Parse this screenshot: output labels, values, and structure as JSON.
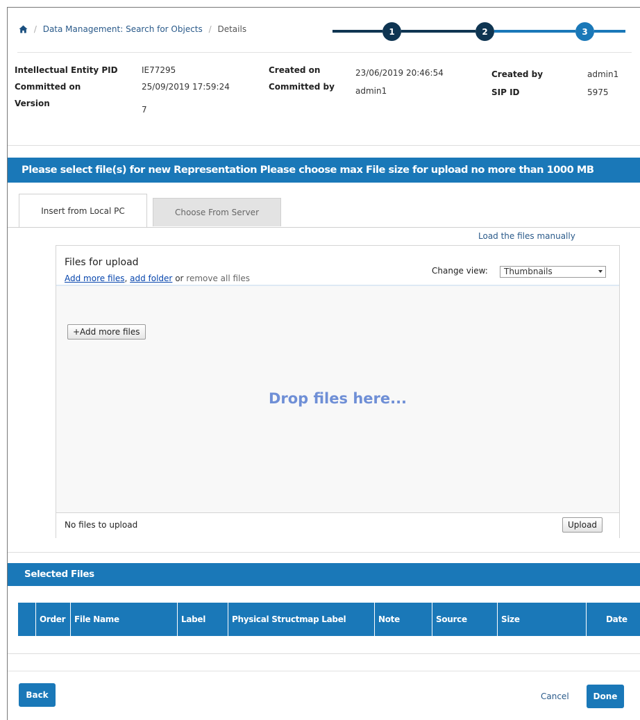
{
  "breadcrumb": {
    "items": [
      "Data Management: Search for Objects",
      "Details"
    ],
    "separator": "/"
  },
  "stepper": {
    "steps": [
      "1",
      "2",
      "3"
    ],
    "current_step": 3,
    "colors": {
      "done": "#0f3552",
      "current": "#1a78b8"
    }
  },
  "metadata": {
    "ie_pid_label": "Intellectual Entity PID",
    "ie_pid_value": "IE77295",
    "committed_on_label": "Committed on",
    "committed_on_value": "25/09/2019 17:59:24",
    "version_label": "Version",
    "version_value": "7",
    "created_on_label": "Created on",
    "created_on_value": "23/06/2019 20:46:54",
    "committed_by_label": "Committed by",
    "committed_by_value": "admin1",
    "created_by_label": "Created by",
    "created_by_value": "admin1",
    "sip_id_label": "SIP ID",
    "sip_id_value": "5975"
  },
  "banner": {
    "text": "Please select file(s) for new Representation Please choose max File size for upload no more than 1000 MB"
  },
  "tabs": [
    {
      "label": "Insert from Local PC",
      "active": true
    },
    {
      "label": "Choose From Server",
      "active": false
    }
  ],
  "load_manually_label": "Load the files manually",
  "uploader": {
    "title": "Files for upload",
    "add_more_link": "Add more files",
    "comma": ", ",
    "add_folder_link": "add folder",
    "or_text": " or ",
    "remove_all_text": "remove all files",
    "change_view_label": "Change view:",
    "view_selected": "Thumbnails",
    "add_more_button": "+Add more files",
    "drop_text": "Drop files here...",
    "status": "No files to upload",
    "upload_button": "Upload"
  },
  "selected_files": {
    "title": "Selected Files",
    "columns": [
      "",
      "Order",
      "File Name",
      "Label",
      "Physical Structmap Label",
      "Note",
      "Source",
      "Size",
      "Date"
    ]
  },
  "actions": {
    "back": "Back",
    "cancel": "Cancel",
    "done": "Done"
  },
  "colors": {
    "accent": "#1a78b8",
    "dark": "#0f3552",
    "link": "#2a5a8a",
    "drop_text": "#6f8fd6"
  }
}
